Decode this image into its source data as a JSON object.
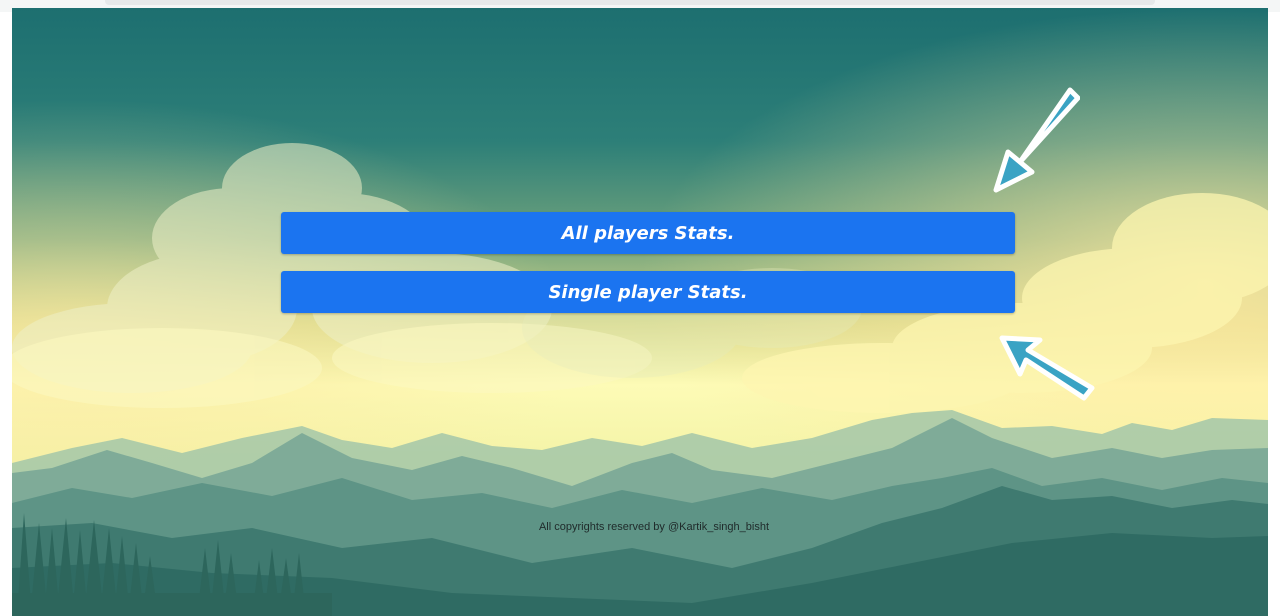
{
  "buttons": {
    "all_players": "All players Stats.",
    "single_player": "Single player Stats."
  },
  "footer": {
    "copyright": "All copyrights reserved by @Kartik_singh_bisht"
  },
  "colors": {
    "button_bg": "#1b74f0",
    "button_text": "#ffffff",
    "sky_top": "#1d6f70",
    "sky_glow": "#fdfbb6",
    "mountain_far": "#8fb9a4",
    "mountain_near": "#2f6b63",
    "arrow_fill": "#3aa3c4"
  },
  "icons": {
    "arrow_top": "arrow-down-left-icon",
    "arrow_bottom": "arrow-up-left-icon"
  }
}
